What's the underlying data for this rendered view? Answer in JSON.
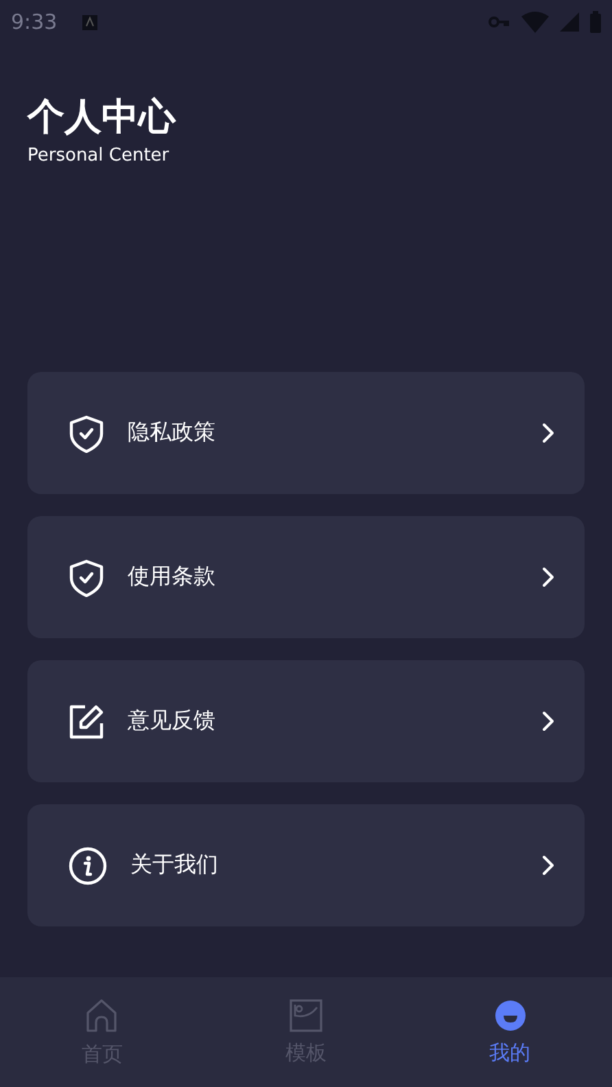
{
  "status_bar": {
    "time": "9:33"
  },
  "header": {
    "title": "个人中心",
    "subtitle": "Personal Center"
  },
  "menu": [
    {
      "kind": "shield",
      "label": "隐私政策"
    },
    {
      "kind": "shield",
      "label": "使用条款"
    },
    {
      "kind": "edit",
      "label": "意见反馈"
    },
    {
      "kind": "info",
      "label": "关于我们"
    }
  ],
  "tabs": [
    {
      "kind": "home",
      "label": "首页",
      "selected": false
    },
    {
      "kind": "image",
      "label": "模板",
      "selected": false
    },
    {
      "kind": "face",
      "label": "我的",
      "selected": true
    }
  ]
}
